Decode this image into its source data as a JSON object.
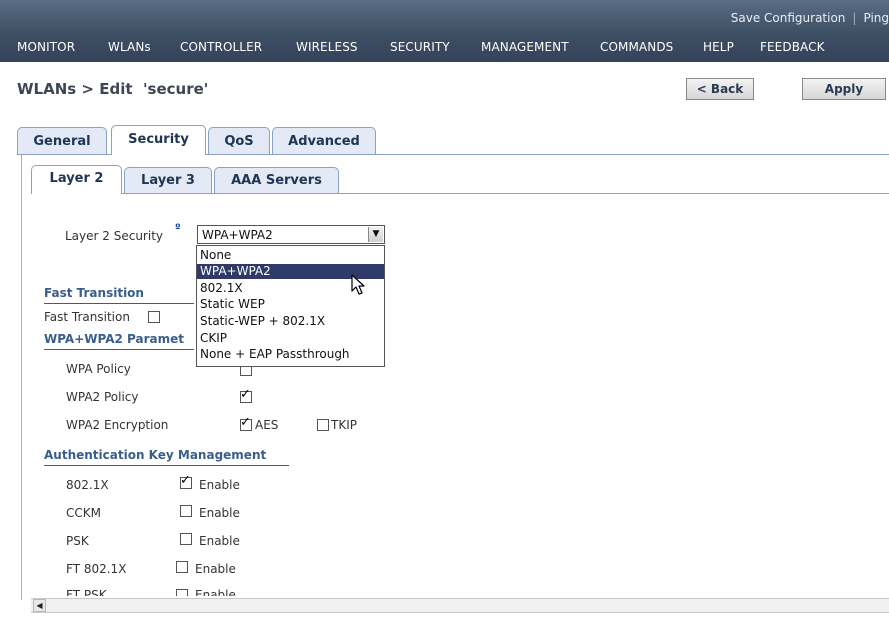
{
  "header": {
    "top_links": [
      "Save Configuration",
      "Ping"
    ],
    "menu": [
      "MONITOR",
      "WLANs",
      "CONTROLLER",
      "WIRELESS",
      "SECURITY",
      "MANAGEMENT",
      "COMMANDS",
      "HELP",
      "FEEDBACK"
    ]
  },
  "page": {
    "title": "WLANs > Edit  'secure'",
    "back_label": "< Back",
    "apply_label": "Apply"
  },
  "tabs": [
    "General",
    "Security",
    "QoS",
    "Advanced"
  ],
  "subtabs": [
    "Layer 2",
    "Layer 3",
    "AAA Servers"
  ],
  "form": {
    "layer2_security_label": "Layer 2 Security",
    "help_icon_glyph": "º",
    "layer2_security_value": "WPA+WPA2",
    "dropdown_options": [
      "None",
      "WPA+WPA2",
      "802.1X",
      "Static WEP",
      "Static-WEP + 802.1X",
      "CKIP",
      "None + EAP Passthrough"
    ],
    "fast_transition_section": "Fast Transition",
    "fast_transition_label": "Fast Transition",
    "wpa_section": "WPA+WPA2 Paramet",
    "wpa_policy_label": "WPA Policy",
    "wpa2_policy_label": "WPA2 Policy",
    "wpa2_encryption_label": "WPA2 Encryption",
    "aes_label": "AES",
    "tkip_label": "TKIP",
    "akm_section": "Authentication Key Management",
    "akm_rows": [
      {
        "label": "802.1X",
        "enable": "Enable"
      },
      {
        "label": "CCKM",
        "enable": "Enable"
      },
      {
        "label": "PSK",
        "enable": "Enable"
      },
      {
        "label": "FT 802.1X",
        "enable": "Enable"
      },
      {
        "label": "FT PSK",
        "enable": "Enable"
      }
    ]
  },
  "colors": {
    "header_bg": "#3e4e63",
    "section_blue": "#3a5e8c",
    "selected_option": "#2f3a69"
  }
}
